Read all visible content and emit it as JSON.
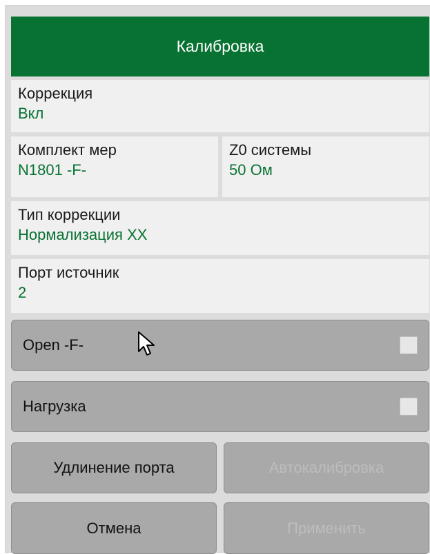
{
  "panel": {
    "title": "Калибровка",
    "correction": {
      "label": "Коррекция",
      "value": "Вкл"
    },
    "cal_kit": {
      "label": "Комплект мер",
      "value": "N1801 -F-"
    },
    "z0": {
      "label": "Z0 системы",
      "value": "50 Ом"
    },
    "correction_type": {
      "label": "Тип коррекции",
      "value": "Нормализация XX"
    },
    "source_port": {
      "label": "Порт источник",
      "value": "2"
    },
    "standards": [
      {
        "label": "Open -F-",
        "checked": false
      },
      {
        "label": "Нагрузка",
        "checked": false
      }
    ],
    "buttons": {
      "port_extension": "Удлинение порта",
      "autocal": "Автокалибровка",
      "cancel": "Отмена",
      "apply": "Применить"
    }
  },
  "colors": {
    "accent": "#077231",
    "panel_bg": "#dcdcdc",
    "field_bg": "#f0f0f0",
    "button_bg": "#a9a9a9",
    "disabled_text": "#bdbdbd"
  },
  "icons": [
    "mouse-cursor-icon"
  ]
}
